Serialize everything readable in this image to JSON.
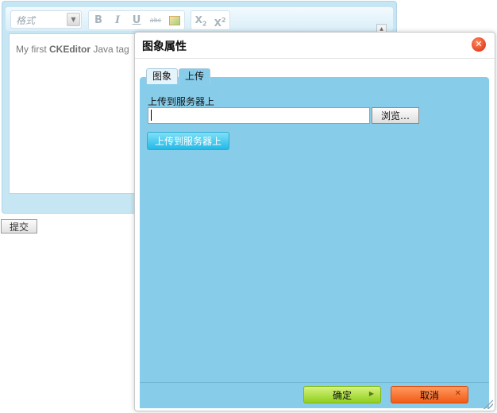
{
  "editor": {
    "format_placeholder": "格式",
    "toolbar": {
      "bold": "B",
      "italic": "I",
      "underline": "U",
      "strike": "abc",
      "subscript": "X",
      "subscript_mark": "2",
      "superscript": "X",
      "superscript_mark": "2"
    },
    "content": {
      "prefix": "My first ",
      "bold": "CKEditor",
      "suffix": " Java tag"
    },
    "submit_label": "提交"
  },
  "dialog": {
    "title": "图象属性",
    "tabs": [
      {
        "label": "图象",
        "active": false
      },
      {
        "label": "上传",
        "active": true
      }
    ],
    "upload_label": "上传到服务器上",
    "file_value": "",
    "browse_label": "浏览…",
    "upload_button_label": "上传到服务器上",
    "ok_label": "确定",
    "cancel_label": "取消",
    "colors": {
      "panel": "#87cdea",
      "ok": "#a6dc3c",
      "cancel": "#f25a16",
      "close": "#e0381a"
    }
  }
}
